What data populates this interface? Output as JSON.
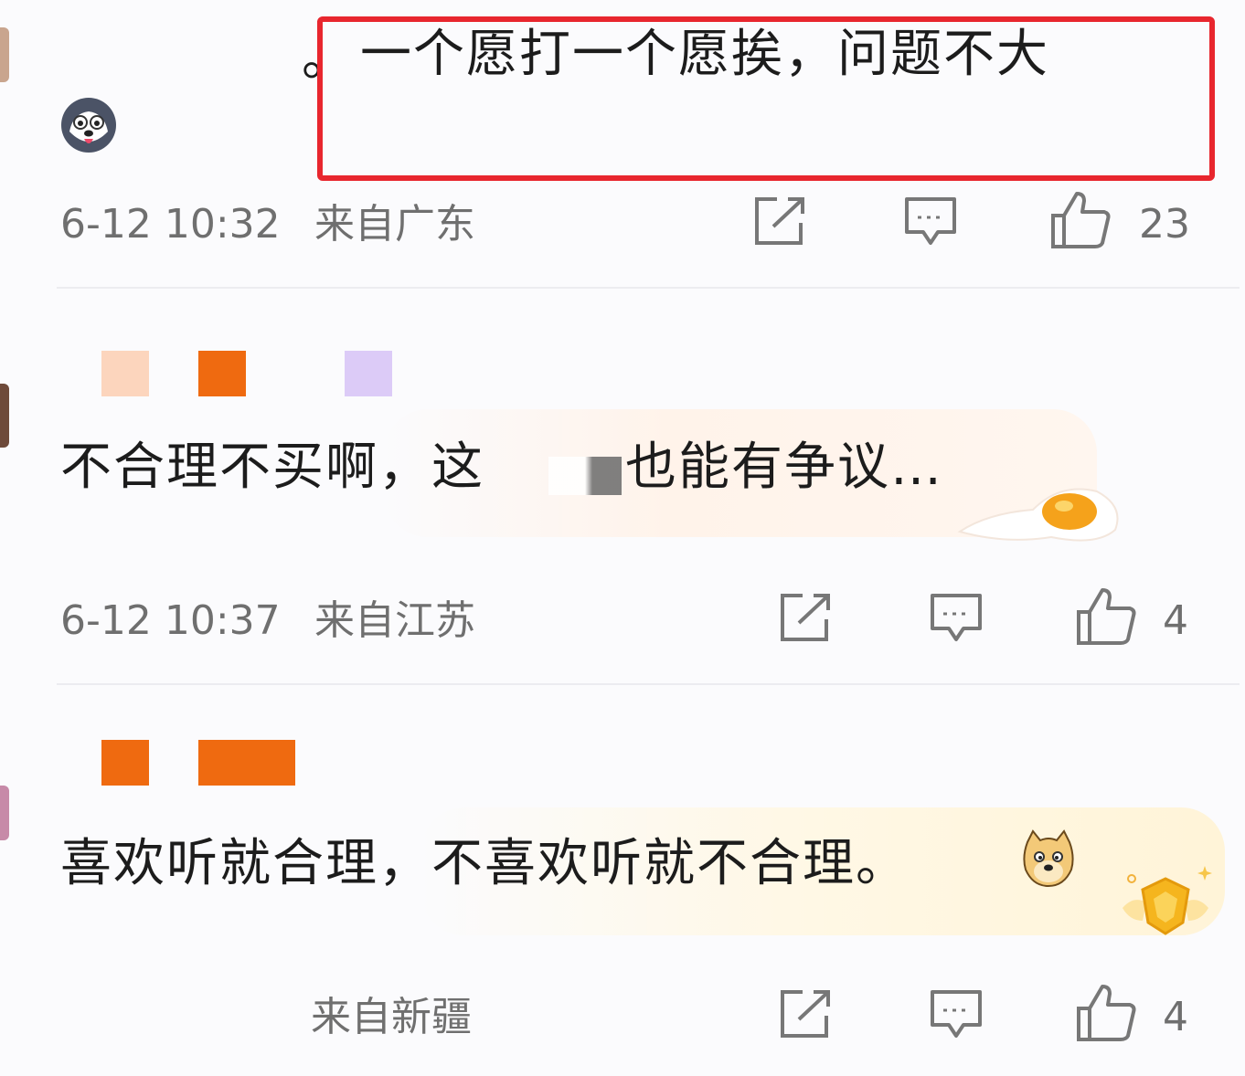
{
  "colors": {
    "highlight_box": "#e8262e",
    "redact_orange": "#ef6a10",
    "redact_peach": "#fcd5bd",
    "redact_lavender": "#dccbf7",
    "meta_text": "#6f6f6f",
    "comment_text": "#1c1c1c"
  },
  "comments": [
    {
      "text_prefix": "。",
      "text": "一个愿打一个愿挨，问题不大",
      "avatar_icon": "husky-emoji-icon",
      "time": "6-12 10:32",
      "location": "来自广东",
      "like_count": "23"
    },
    {
      "text": "不合理不买啊，这",
      "text_tail": "也能有争议…",
      "sticker_icon": "fried-egg-decoration-icon",
      "time": "6-12 10:37",
      "location": "来自江苏",
      "like_count": "4"
    },
    {
      "text": "喜欢听就合理，不喜欢听就不合理。",
      "emoji_icon": "doge-emoji-icon",
      "badge_icon": "gold-shield-badge-icon",
      "time": "",
      "location": "来自新疆",
      "like_count": "4"
    }
  ],
  "icons": {
    "share": "share-icon",
    "reply": "comment-icon",
    "like": "thumbs-up-icon"
  }
}
